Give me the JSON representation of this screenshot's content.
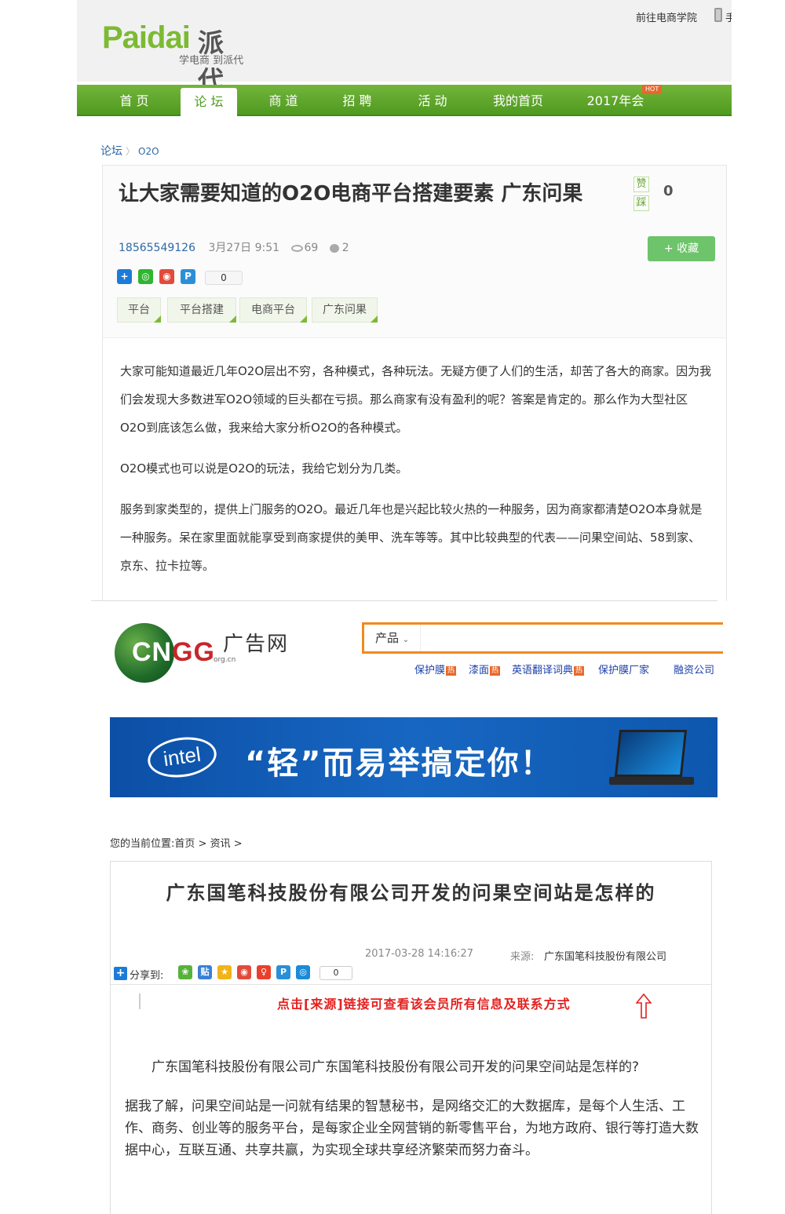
{
  "paidai": {
    "logo_en": "Paidai",
    "logo_cn": "派代",
    "slogan": "学电商 到派代",
    "top_link": "前往电商学院",
    "top_suffix": "手",
    "nav": [
      {
        "label": "首 页"
      },
      {
        "label": "论 坛"
      },
      {
        "label": "商 道"
      },
      {
        "label": "招 聘"
      },
      {
        "label": "活 动"
      },
      {
        "label": "我的首页"
      },
      {
        "label": "2017年会"
      }
    ],
    "hot_badge": "HOT",
    "breadcrumb": {
      "root": "论坛",
      "sep": "〉",
      "current": "O2O"
    },
    "post": {
      "title": "让大家需要知道的O2O电商平台搭建要素 广东问果",
      "author": "18565549126",
      "date": "3月27日 9:51",
      "views": "69",
      "comments": "2",
      "vote_up": "赞",
      "vote_down": "踩",
      "vote_count": "0",
      "favorite": "+ 收藏",
      "share_count": "0",
      "tags": [
        "平台",
        "平台搭建",
        "电商平台",
        "广东问果"
      ],
      "paragraphs": [
        "大家可能知道最近几年O2O层出不穷，各种模式，各种玩法。无疑方便了人们的生活，却苦了各大的商家。因为我们会发现大多数进军O2O领域的巨头都在亏损。那么商家有没有盈利的呢？答案是肯定的。那么作为大型社区O2O到底该怎么做，我来给大家分析O2O的各种模式。",
        "O2O模式也可以说是O2O的玩法，我给它划分为几类。",
        "服务到家类型的，提供上门服务的O2O。最近几年也是兴起比较火热的一种服务，因为商家都清楚O2O本身就是一种服务。呆在家里面就能享受到商家提供的美甲、洗车等等。其中比较典型的代表——问果空间站、58到家、京东、拉卡拉等。"
      ]
    }
  },
  "cngg": {
    "logo_letters_cn": "CN",
    "logo_letters_gg": "GG",
    "logo_domain": "org.cn",
    "brand": "广告网",
    "search_category": "产品",
    "search_value": "",
    "hot_label": "热",
    "hot_links": [
      {
        "label": "保护膜",
        "hot": true
      },
      {
        "label": "漆面",
        "hot": true
      },
      {
        "label": "英语翻译词典",
        "hot": true
      },
      {
        "label": "保护膜厂家",
        "hot": false
      },
      {
        "label": "融资公司",
        "hot": false
      }
    ],
    "banner": {
      "brand": "intel",
      "slogan": "“轻”而易举搞定你！"
    }
  },
  "article": {
    "position_label": "您的当前位置:",
    "position_home": "首页",
    "position_sep": ">",
    "position_section": "资讯",
    "title": "广东国笔科技股份有限公司开发的问果空间站是怎样的",
    "date": "2017-03-28 14:16:27",
    "source_label": "来源:",
    "source": "广东国笔科技股份有限公司",
    "share_label": "分享到:",
    "share_count": "0",
    "notice": "点击[来源]链接可查看该会员所有信息及联系方式",
    "lead": "广东国笔科技股份有限公司广东国笔科技股份有限公司开发的问果空间站是怎样的?",
    "body": "据我了解，问果空间站是一问就有结果的智慧秘书，是网络交汇的大数据库，是每个人生活、工作、商务、创业等的服务平台，是每家企业全网营销的新零售平台，为地方政府、银行等打造大数据中心，互联互通、共享共赢，为实现全球共享经济繁荣而努力奋斗。"
  },
  "colors": {
    "paidai_green": "#7cba33",
    "nav_green": "#4f9a20",
    "cngg_orange": "#f08a1f",
    "notice_red": "#e3211f",
    "link_blue": "#1a3fa8"
  }
}
